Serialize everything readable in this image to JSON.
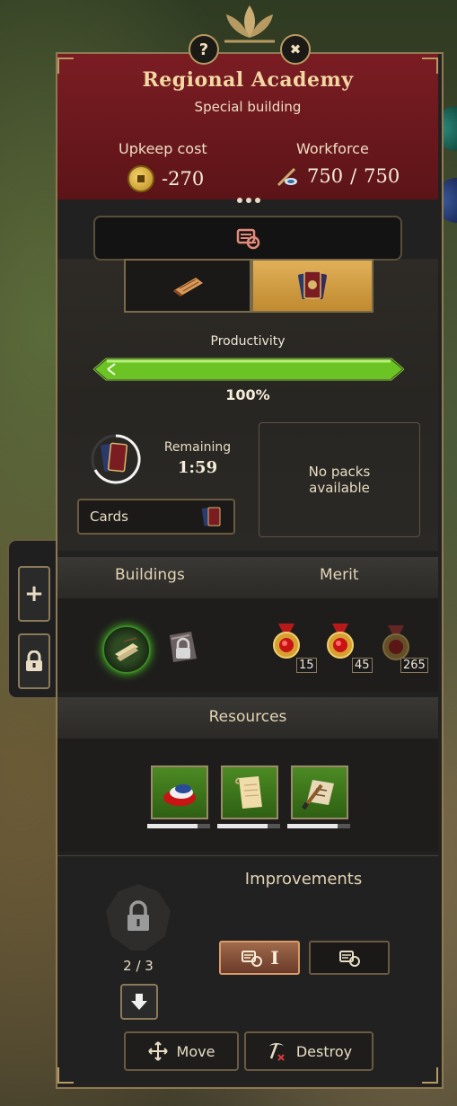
{
  "header": {
    "title": "Regional Academy",
    "subtitle": "Special building",
    "upkeep_label": "Upkeep cost",
    "upkeep_value": "-270",
    "workforce_label": "Workforce",
    "workforce_current": "750",
    "workforce_sep": "/",
    "workforce_max": "750"
  },
  "top_buttons": {
    "help": "?",
    "close": "✖"
  },
  "production": {
    "productivity_label": "Productivity",
    "productivity_percent": "100%",
    "productivity_level": 1.0,
    "remaining_label": "Remaining",
    "remaining_time": "1:59",
    "cards_button_label": "Cards",
    "no_packs_text": "No packs available"
  },
  "sections": {
    "buildings_label": "Buildings",
    "merit_label": "Merit",
    "resources_label": "Resources",
    "improvements_label": "Improvements"
  },
  "merits": [
    {
      "count": "15"
    },
    {
      "count": "45"
    },
    {
      "count": "265"
    }
  ],
  "resources": [
    {
      "icon": "fabric-icon",
      "fill": 0.8
    },
    {
      "icon": "paper-icon",
      "fill": 0.8
    },
    {
      "icon": "scroll-brush-icon",
      "fill": 0.8
    }
  ],
  "improvements": {
    "slots_counter": "2 / 3",
    "level_label": "I"
  },
  "actions": {
    "move_label": "Move",
    "destroy_label": "Destroy"
  },
  "side_tabs": {
    "add": "+",
    "lock": "lock-icon"
  },
  "colors": {
    "header_red": "#7a1d23",
    "gold_border": "#b69a62",
    "accent_green": "#6bc424"
  }
}
